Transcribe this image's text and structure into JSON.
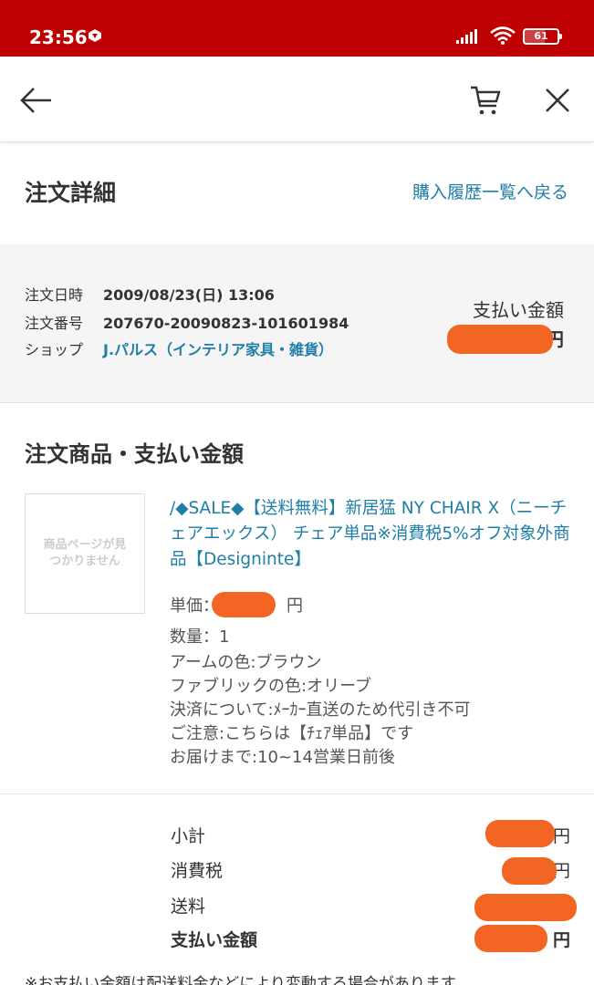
{
  "status_bar": {
    "time": "23:56",
    "battery": "61"
  },
  "page": {
    "title": "注文詳細",
    "history_link": "購入履歴一覧へ戻る"
  },
  "order": {
    "date_label": "注文日時",
    "date_value": "2009/08/23(日) 13:06",
    "number_label": "注文番号",
    "number_value": "207670-20090823-101601984",
    "shop_label": "ショップ",
    "shop_value": "J.パルス（インテリア家具・雑貨）",
    "payment_label": "支払い金額",
    "payment_currency": "円"
  },
  "items_section": {
    "title": "注文商品・支払い金額",
    "thumbnail_text": "商品ページが見つかりません",
    "product_name": "/◆SALE◆【送料無料】新居猛 NY CHAIR X（ニーチェアエックス） チェア単品※消費税5%オフ対象外商品【Designinte】",
    "unit_price_label": "単価：",
    "unit_price_currency": "円",
    "quantity": "数量：1",
    "options": [
      "アームの色:ブラウン",
      "ファブリックの色:オリーブ",
      "決済について:ﾒｰｶｰ直送のため代引き不可",
      "ご注意:こちらは【ﾁｪｱ単品】です",
      "お届けまで:10~14営業日前後"
    ]
  },
  "summary": {
    "subtotal_label": "小計",
    "tax_label": "消費税",
    "shipping_label": "送料",
    "total_label": "支払い金額",
    "currency": "円"
  },
  "footer_note": "※お支払い金額は配送料金などにより変動する場合があります。",
  "colors": {
    "brand_red": "#bf0000",
    "link_blue": "#1f7ea6",
    "redaction": "#f26522"
  }
}
